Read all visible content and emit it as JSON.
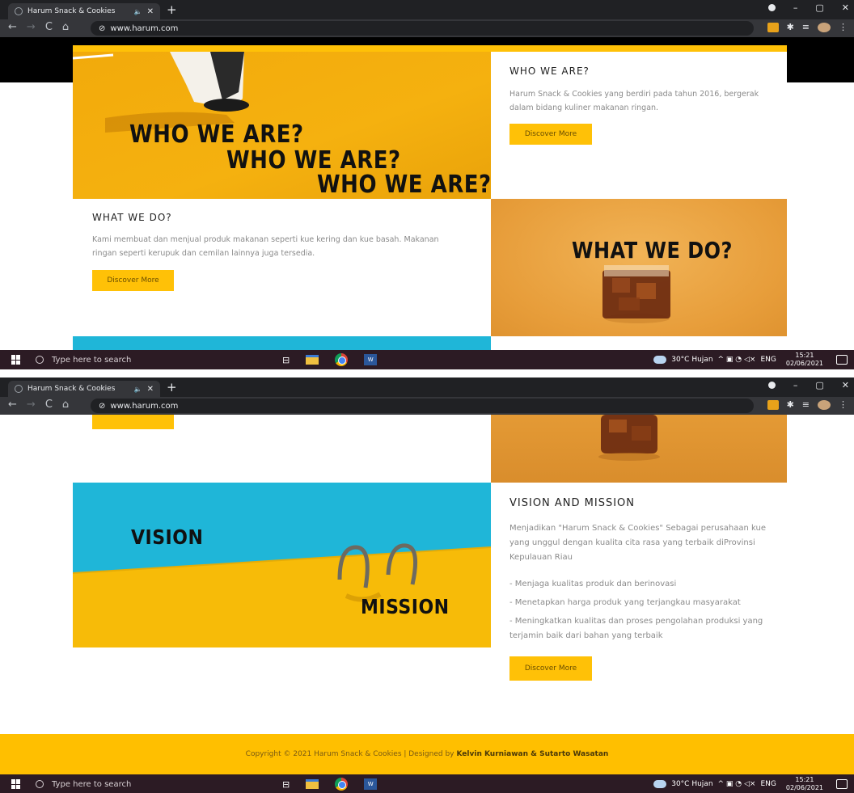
{
  "browser": {
    "tab_title": "Harum Snack & Cookies",
    "tab_audio": "🔈",
    "tab_close": "✕",
    "new_tab": "+",
    "url": "www.harum.com",
    "nav_back": "←",
    "nav_forward": "→",
    "nav_reload": "C",
    "nav_home": "⌂",
    "win_min": "–",
    "win_max": "▢",
    "win_close": "✕"
  },
  "taskbar": {
    "search_placeholder": "Type here to search",
    "weather": "30°C  Hujan",
    "tray_icons": "^ ▣ ◔ ◁×",
    "language": "ENG",
    "time": "15:21",
    "date": "02/06/2021"
  },
  "who": {
    "image_lines": [
      "WHO WE ARE?",
      "WHO WE ARE?",
      "WHO WE ARE?"
    ],
    "heading": "WHO WE ARE?",
    "text": "Harum Snack & Cookies yang berdiri pada tahun 2016, bergerak dalam bidang kuliner makanan ringan.",
    "button": "Discover More"
  },
  "what": {
    "heading": "WHAT WE DO?",
    "text": "Kami membuat dan menjual produk makanan seperti kue kering dan kue basah. Makanan ringan seperti kerupuk dan cemilan lainnya juga tersedia.",
    "button": "Discover More",
    "image_text": "WHAT WE DO?"
  },
  "vision": {
    "image_vision": "VISION",
    "image_mission": "MISSION",
    "heading": "VISION AND MISSION",
    "text": "Menjadikan \"Harum Snack & Cookies\" Sebagai perusahaan kue yang unggul dengan kualita cita rasa yang terbaik diProvinsi Kepulauan Riau",
    "missions": [
      "- Menjaga kualitas produk dan berinovasi",
      "- Menetapkan harga produk yang terjangkau masyarakat",
      "- Meningkatkan kualitas dan proses pengolahan produksi yang terjamin baik dari bahan yang terbaik"
    ],
    "button": "Discover More"
  },
  "footer": {
    "copyright": "Copyright © 2021 Harum Snack & Cookies | Designed by",
    "designers": "Kelvin Kurniawan & Sutarto Wasatan"
  },
  "colors": {
    "accent": "#ffc107",
    "footer": "#ffbf00",
    "sky": "#1fb6d8"
  }
}
